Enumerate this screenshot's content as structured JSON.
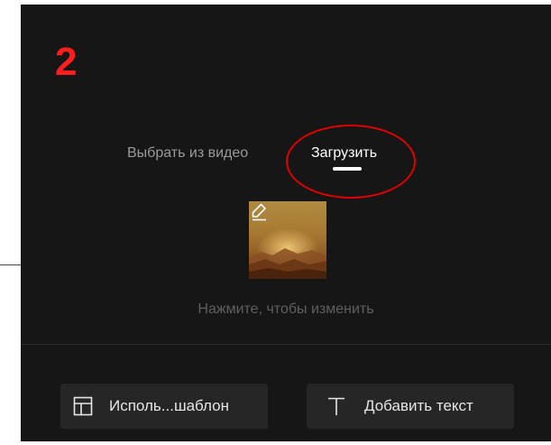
{
  "annotation": {
    "step_number": "2",
    "ellipse_color": "#e00000",
    "number_color": "#ff1d1d"
  },
  "tabs": [
    {
      "label": "Выбрать из видео",
      "active": false
    },
    {
      "label": "Загрузить",
      "active": true
    }
  ],
  "cover": {
    "edit_icon": "pencil-icon",
    "hint": "Нажмите, чтобы изменить"
  },
  "buttons": {
    "template": {
      "label": "Исполь...шаблон",
      "icon": "layout-template-icon"
    },
    "add_text": {
      "label": "Добавить текст",
      "icon": "text-t-icon"
    }
  },
  "colors": {
    "panel_background": "#161616",
    "button_background": "#262626",
    "active_tab": "#ffffff",
    "inactive_tab": "#9a9a9a"
  }
}
